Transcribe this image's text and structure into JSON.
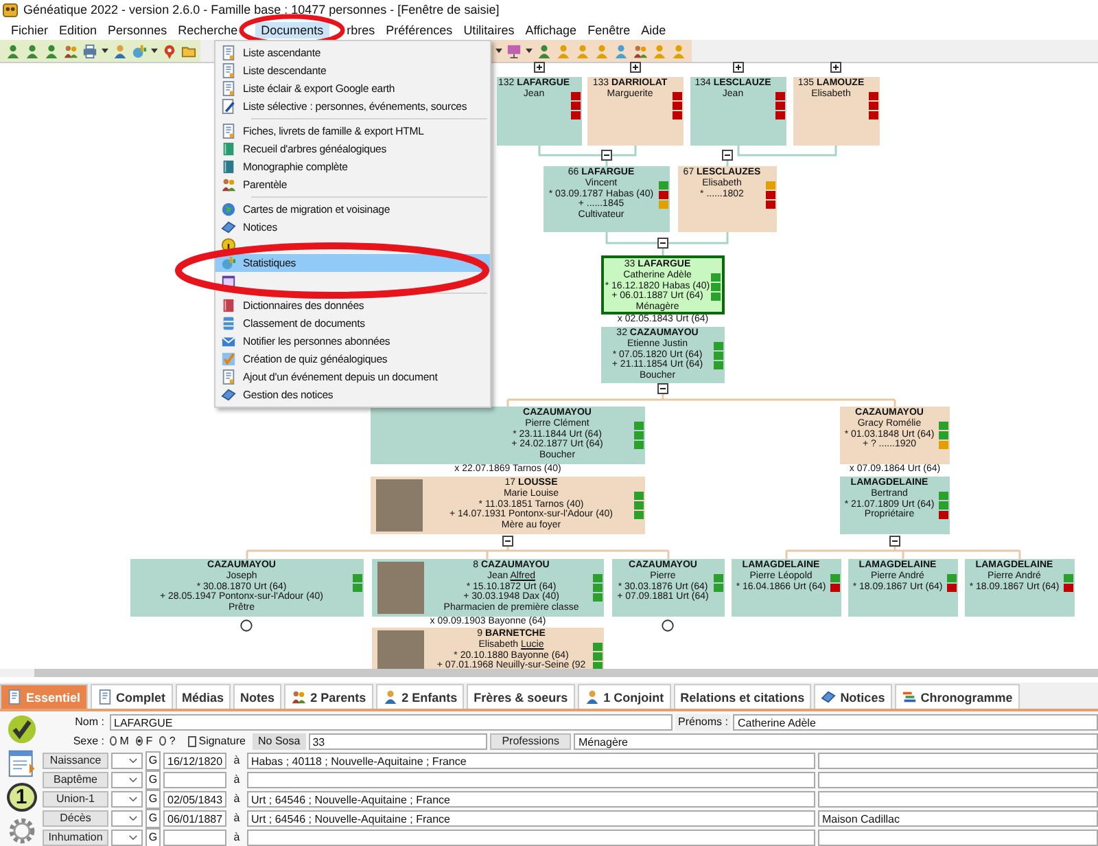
{
  "window": {
    "title": "Généatique 2022 - version 2.6.0 - Famille base : 10477 personnes - [Fenêtre de saisie]"
  },
  "menu_bar": [
    {
      "label": "Fichier",
      "selected": false
    },
    {
      "label": "Edition",
      "selected": false
    },
    {
      "label": "Personnes",
      "selected": false
    },
    {
      "label": "Recherche",
      "selected": false
    },
    {
      "label": "Documents",
      "selected": true
    },
    {
      "label": "rbres",
      "selected": false
    },
    {
      "label": "Préférences",
      "selected": false
    },
    {
      "label": "Utilitaires",
      "selected": false
    },
    {
      "label": "Affichage",
      "selected": false
    },
    {
      "label": "Fenêtre",
      "selected": false
    },
    {
      "label": "Aide",
      "selected": false
    }
  ],
  "dropdown": [
    {
      "kind": "item",
      "label": "Liste ascendante",
      "selected": false
    },
    {
      "kind": "item",
      "label": "Liste descendante",
      "selected": false
    },
    {
      "kind": "item",
      "label": "Liste éclair & export Google earth",
      "selected": false
    },
    {
      "kind": "item",
      "label": "Liste sélective : personnes, événements, sources",
      "selected": false
    },
    {
      "kind": "separator"
    },
    {
      "kind": "item",
      "label": "Fiches, livrets de famille & export HTML",
      "selected": false
    },
    {
      "kind": "item",
      "label": "Recueil d'arbres généalogiques",
      "selected": false
    },
    {
      "kind": "item",
      "label": "Monographie complète",
      "selected": false
    },
    {
      "kind": "item",
      "label": "Parentèle",
      "selected": false
    },
    {
      "kind": "separator"
    },
    {
      "kind": "item",
      "label": "Cartes de migration et voisinage",
      "selected": false
    },
    {
      "kind": "item",
      "label": "Notices",
      "selected": false
    },
    {
      "kind": "covered"
    },
    {
      "kind": "item",
      "label": "Statistiques",
      "selected": true
    },
    {
      "kind": "covered"
    },
    {
      "kind": "separator"
    },
    {
      "kind": "item",
      "label": "Dictionnaires des données",
      "selected": false
    },
    {
      "kind": "item",
      "label": "Classement de documents",
      "selected": false
    },
    {
      "kind": "item",
      "label": "Notifier les personnes abonnées",
      "selected": false
    },
    {
      "kind": "item",
      "label": "Création de quiz généalogiques",
      "selected": false
    },
    {
      "kind": "item",
      "label": "Ajout d'un événement depuis un document",
      "selected": false
    },
    {
      "kind": "item",
      "label": "Gestion des notices",
      "selected": false
    }
  ],
  "tree": {
    "nodes": [
      {
        "heading": "132 **LAFARGUE**",
        "first_names": "Jean",
        "kind": "male",
        "selected": false,
        "marks": [
          {
            "color": "#c00000"
          },
          {
            "color": "#c00000"
          },
          {
            "color": "#c00000"
          }
        ]
      },
      {
        "heading": "133 **DARRIOLAT**",
        "first_names": "Marguerite",
        "kind": "female",
        "selected": false,
        "marks": [
          {
            "color": "#c00000"
          },
          {
            "color": "#c00000"
          },
          {
            "color": "#c00000"
          }
        ]
      },
      {
        "heading": "134 **LESCLAUZE**",
        "first_names": "Jean",
        "kind": "male",
        "selected": false,
        "marks": [
          {
            "color": "#c00000"
          },
          {
            "color": "#c00000"
          },
          {
            "color": "#c00000"
          }
        ]
      },
      {
        "heading": "135 **LAMOUZE**",
        "first_names": "Elisabeth",
        "kind": "female",
        "selected": false,
        "marks": [
          {
            "color": "#c00000"
          },
          {
            "color": "#c00000"
          },
          {
            "color": "#c00000"
          }
        ]
      },
      {
        "heading": "66 **LAFARGUE**",
        "first_names": "Vincent",
        "lines": [
          "* 03.09.1787 Habas (40)",
          "+ ......1845",
          "Cultivateur"
        ],
        "kind": "male",
        "selected": false,
        "marks": [
          {
            "color": "#2ca02c"
          },
          {
            "color": "#c00000"
          },
          {
            "color": "#e0a000"
          }
        ]
      },
      {
        "heading": "67 **LESCLAUZES**",
        "first_names": "Elisabeth",
        "lines": [
          "* ......1802"
        ],
        "kind": "female",
        "selected": false,
        "marks": [
          {
            "color": "#e0a000"
          },
          {
            "color": "#c00000"
          },
          {
            "color": "#c00000"
          }
        ]
      },
      {
        "heading": "33 **LAFARGUE**",
        "first_names": "Catherine Adèle",
        "lines": [
          "* 16.12.1820 Habas (40)",
          "+ 06.01.1887 Urt (64)",
          "Ménagère"
        ],
        "kind": "female",
        "selected": true,
        "marks": [
          {
            "color": "#2ca02c"
          },
          {
            "color": "#2ca02c"
          },
          {
            "color": "#2ca02c"
          }
        ],
        "marriage": "x 02.05.1843 Urt (64)"
      },
      {
        "heading": "32 **CAZAUMAYOU**",
        "first_names": "Etienne Justin",
        "lines": [
          "* 07.05.1820 Urt (64)",
          "+ 21.11.1854 Urt (64)",
          "Boucher"
        ],
        "kind": "male",
        "selected": false,
        "marks": [
          {
            "color": "#2ca02c"
          },
          {
            "color": "#2ca02c"
          },
          {
            "color": "#2ca02c"
          }
        ]
      },
      {
        "heading": "**CAZAUMAYOU**",
        "first_names": "Pierre Clément",
        "lines": [
          "* 23.11.1844 Urt (64)",
          "+ 24.02.1877 Urt (64)",
          "Boucher"
        ],
        "kind": "male",
        "selected": false,
        "marks": [
          {
            "color": "#2ca02c"
          },
          {
            "color": "#2ca02c"
          },
          {
            "color": "#2ca02c"
          }
        ],
        "marriage": "x 22.07.1869 Tarnos (40)"
      },
      {
        "heading": "17 **LOUSSE**",
        "first_names": "Marie Louise",
        "lines": [
          "* 11.03.1851 Tarnos (40)",
          "+ 14.07.1931 Pontonx-sur-l'Adour (40)",
          "Mère au foyer"
        ],
        "kind": "female",
        "selected": false,
        "photo": true,
        "marks": [
          {
            "color": "#2ca02c"
          },
          {
            "color": "#2ca02c"
          },
          {
            "color": "#2ca02c"
          }
        ]
      },
      {
        "heading": "**CAZAUMAYOU**",
        "first_names": "Gracy Romélie",
        "lines": [
          "* 01.03.1848 Urt (64)",
          "+ ? ......1920"
        ],
        "kind": "female",
        "selected": false,
        "marks": [
          {
            "color": "#2ca02c"
          },
          {
            "color": "#2ca02c"
          },
          {
            "color": "#e0a000"
          }
        ],
        "marriage": "x 07.09.1864 Urt (64)"
      },
      {
        "heading": "**LAMAGDELAINE**",
        "first_names": "Bertrand",
        "lines": [
          "* 21.07.1809 Urt (64)",
          "Propriétaire"
        ],
        "kind": "male",
        "selected": false,
        "marks": [
          {
            "color": "#2ca02c"
          },
          {
            "color": "#2ca02c"
          },
          {
            "color": "#c00000"
          }
        ]
      },
      {
        "heading": "**CAZAUMAYOU**",
        "first_names": "Joseph",
        "lines": [
          "* 30.08.1870 Urt (64)",
          "+ 28.05.1947 Pontonx-sur-l'Adour (40)",
          "Prêtre"
        ],
        "kind": "male",
        "selected": false,
        "marks": [
          {
            "color": "#2ca02c"
          },
          {
            "color": "#2ca02c"
          }
        ],
        "end_marker": true
      },
      {
        "heading": "8 **CAZAUMAYOU**",
        "first_names": "Jean",
        "usual_name": "Alfred",
        "lines": [
          "* 15.10.1872 Urt (64)",
          "+ 30.03.1948 Dax (40)",
          "Pharmacien de première classe"
        ],
        "kind": "male",
        "selected": false,
        "photo": true,
        "marks": [
          {
            "color": "#2ca02c"
          },
          {
            "color": "#2ca02c"
          },
          {
            "color": "#2ca02c"
          }
        ],
        "marriage": "x 09.09.1903 Bayonne (64)"
      },
      {
        "heading": "**CAZAUMAYOU**",
        "first_names": "Pierre",
        "lines": [
          "* 30.03.1876 Urt (64)",
          "+ 07.09.1881 Urt (64)"
        ],
        "kind": "male",
        "selected": false,
        "marks": [
          {
            "color": "#2ca02c"
          },
          {
            "color": "#2ca02c"
          }
        ],
        "end_marker": true
      },
      {
        "heading": "**LAMAGDELAINE**",
        "first_names": "Pierre Léopold",
        "lines": [
          "* 16.04.1866 Urt (64)"
        ],
        "kind": "male",
        "selected": false,
        "marks": [
          {
            "color": "#2ca02c"
          },
          {
            "color": "#c00000"
          }
        ]
      },
      {
        "heading": "**LAMAGDELAINE**",
        "first_names": "Pierre André",
        "lines": [
          "* 18.09.1867 Urt (64)"
        ],
        "kind": "male",
        "selected": false,
        "marks": [
          {
            "color": "#2ca02c"
          },
          {
            "color": "#c00000"
          }
        ]
      },
      {
        "heading": "**LAMAGDELAINE**",
        "first_names": "Pierre André",
        "lines": [
          "* 18.09.1867 Urt (64)"
        ],
        "kind": "male",
        "selected": false,
        "marks": [
          {
            "color": "#2ca02c"
          },
          {
            "color": "#c00000"
          }
        ]
      },
      {
        "heading": "9 **BARNETCHE**",
        "first_names": "Elisabeth",
        "usual_name": "Lucie",
        "lines": [
          "* 20.10.1880 Bayonne (64)",
          "+ 07.01.1968 Neuilly-sur-Seine (92"
        ],
        "kind": "female",
        "selected": false,
        "photo": true,
        "marks": [
          {
            "color": "#2ca02c"
          },
          {
            "color": "#2ca02c"
          },
          {
            "color": "#2ca02c"
          }
        ]
      }
    ]
  },
  "tabs": [
    {
      "label": "Essentiel",
      "selected": true
    },
    {
      "label": "Complet",
      "selected": false
    },
    {
      "label": "Médias",
      "selected": false
    },
    {
      "label": "Notes",
      "selected": false
    },
    {
      "label": "2 Parents",
      "selected": false
    },
    {
      "label": "2 Enfants",
      "selected": false
    },
    {
      "label": "Frères & soeurs",
      "selected": false
    },
    {
      "label": "1 Conjoint",
      "selected": false
    },
    {
      "label": "Relations et citations",
      "selected": false
    },
    {
      "label": "Notices",
      "selected": false
    },
    {
      "label": "Chronogramme",
      "selected": false
    }
  ],
  "side_badge": "1",
  "form": {
    "name_label": "Nom :",
    "name": "LAFARGUE",
    "given_label": "Prénoms :",
    "given": "Catherine Adèle",
    "sex_label": "Sexe :",
    "sex_options": [
      {
        "label": "M",
        "selected": false
      },
      {
        "label": "F",
        "selected": true
      },
      {
        "label": "?",
        "selected": false
      }
    ],
    "signature": {
      "label": "Signature",
      "checked": false
    },
    "sosa_label": "No Sosa",
    "sosa": "33",
    "professions_button": "Professions",
    "profession": "Ménagère",
    "events": [
      {
        "label": "Naissance",
        "source": "G",
        "date": "16/12/1820",
        "at": "à",
        "place": "Habas ; 40118 ; Nouvelle-Aquitaine ; France"
      },
      {
        "label": "Baptême",
        "source": "G",
        "at": "à"
      },
      {
        "label": "Union-1",
        "source": "G",
        "date": "02/05/1843",
        "at": "à",
        "place": "Urt ; 64546 ; Nouvelle-Aquitaine ; France"
      },
      {
        "label": "Décès",
        "source": "G",
        "date": "06/01/1887",
        "at": "à",
        "place": "Urt ; 64546 ; Nouvelle-Aquitaine ; France",
        "detail": "Maison Cadillac"
      },
      {
        "label": "Inhumation",
        "source": "G",
        "at": "à"
      }
    ]
  }
}
